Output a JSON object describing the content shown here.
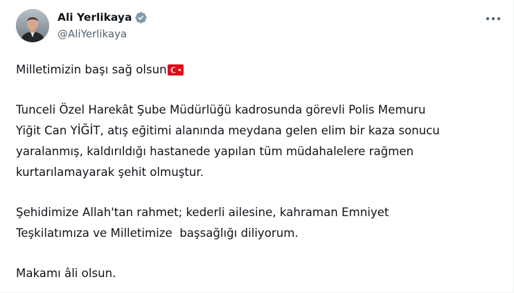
{
  "author": {
    "display_name": "Ali Yerlikaya",
    "handle": "@AliYerlikaya",
    "verified": true
  },
  "icons": {
    "verified": "verified-badge-icon",
    "more": "more-options-icon",
    "flag": "turkey-flag-icon"
  },
  "colors": {
    "verified_badge": "#829aab",
    "handle": "#536471",
    "text": "#0f1419",
    "flag_red": "#e30a17"
  },
  "tweet": {
    "line1": "Milletimizin başı sağ olsun",
    "para2_line1": "Tunceli Özel Harekât Şube Müdürlüğü kadrosunda görevli Polis Memuru",
    "para2_line2": "Yiğit Can YİĞİT, atış eğitimi alanında meydana gelen elim bir kaza sonucu",
    "para2_line3": "yaralanmış, kaldırıldığı hastanede yapılan tüm müdahalelere rağmen",
    "para2_line4": "kurtarılamayarak şehit olmuştur.",
    "para3_line1": "Şehidimize Allah'tan rahmet; kederli ailesine, kahraman Emniyet",
    "para3_line2": "Teşkilatımıza ve Milletimize  başsağlığı diliyorum.",
    "line_last": "Makamı âli olsun."
  }
}
